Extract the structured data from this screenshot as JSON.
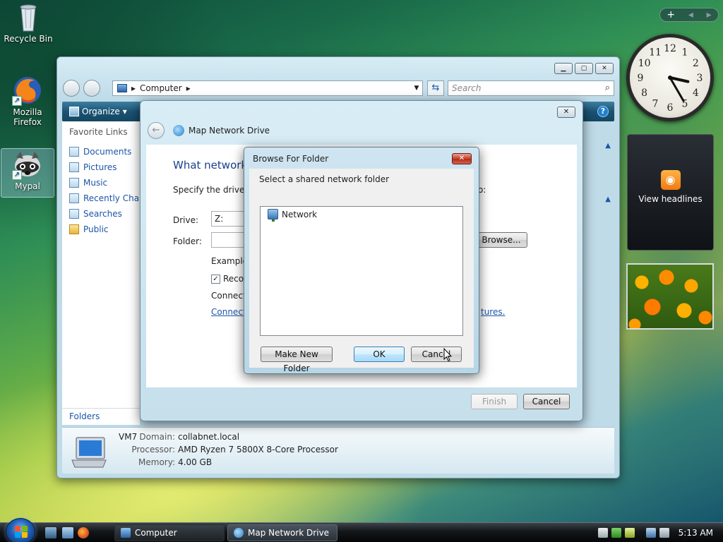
{
  "desktop": {
    "icons": [
      {
        "label": "Recycle Bin"
      },
      {
        "label": "Mozilla Firefox"
      },
      {
        "label": "Mypal"
      }
    ]
  },
  "gadgets": {
    "bar_buttons": [
      "+",
      "◂",
      "▸"
    ],
    "clock": {
      "time": "3:25",
      "numerals": [
        "12",
        "1",
        "2",
        "3",
        "4",
        "5",
        "6",
        "7",
        "8",
        "9",
        "10",
        "11"
      ]
    },
    "feed": {
      "label": "View headlines"
    }
  },
  "explorer": {
    "address": {
      "segment": "Computer"
    },
    "search": {
      "placeholder": "Search"
    },
    "toolbar": {
      "organize_label": "Organize"
    },
    "nav": {
      "header": "Favorite Links",
      "links": [
        "Documents",
        "Pictures",
        "Music",
        "Recently Chang",
        "Searches",
        "Public"
      ],
      "folders_label": "Folders"
    },
    "details": {
      "name": "VM7",
      "domain_label": "Domain:",
      "domain_value": "collabnet.local",
      "processor_label": "Processor:",
      "processor_value": "AMD Ryzen 7 5800X 8-Core Processor",
      "memory_label": "Memory:",
      "memory_value": "4.00 GB"
    }
  },
  "map_network_drive": {
    "title": "Map Network Drive",
    "heading": "What network",
    "instruction_start": "Specify the drive le",
    "instruction_end": "o:",
    "drive_label": "Drive:",
    "drive_value": "Z:",
    "folder_label": "Folder:",
    "browse_label": "Browse...",
    "example_label": "Example:",
    "reconnect_label": "Recon",
    "connect_text": "Connect",
    "connect_link": "Connect",
    "pictures_link": "tures.",
    "finish_label": "Finish",
    "cancel_label": "Cancel"
  },
  "browse_for_folder": {
    "title": "Browse For Folder",
    "close_label": "✕",
    "instruction": "Select a shared network folder",
    "tree": [
      {
        "label": "Network"
      }
    ],
    "make_new_folder_label": "Make New Folder",
    "ok_label": "OK",
    "cancel_label": "Cancel"
  },
  "taskbar": {
    "buttons": [
      {
        "label": "Computer",
        "active": false
      },
      {
        "label": "Map Network Drive",
        "active": true
      }
    ],
    "clock": "5:13 AM"
  }
}
